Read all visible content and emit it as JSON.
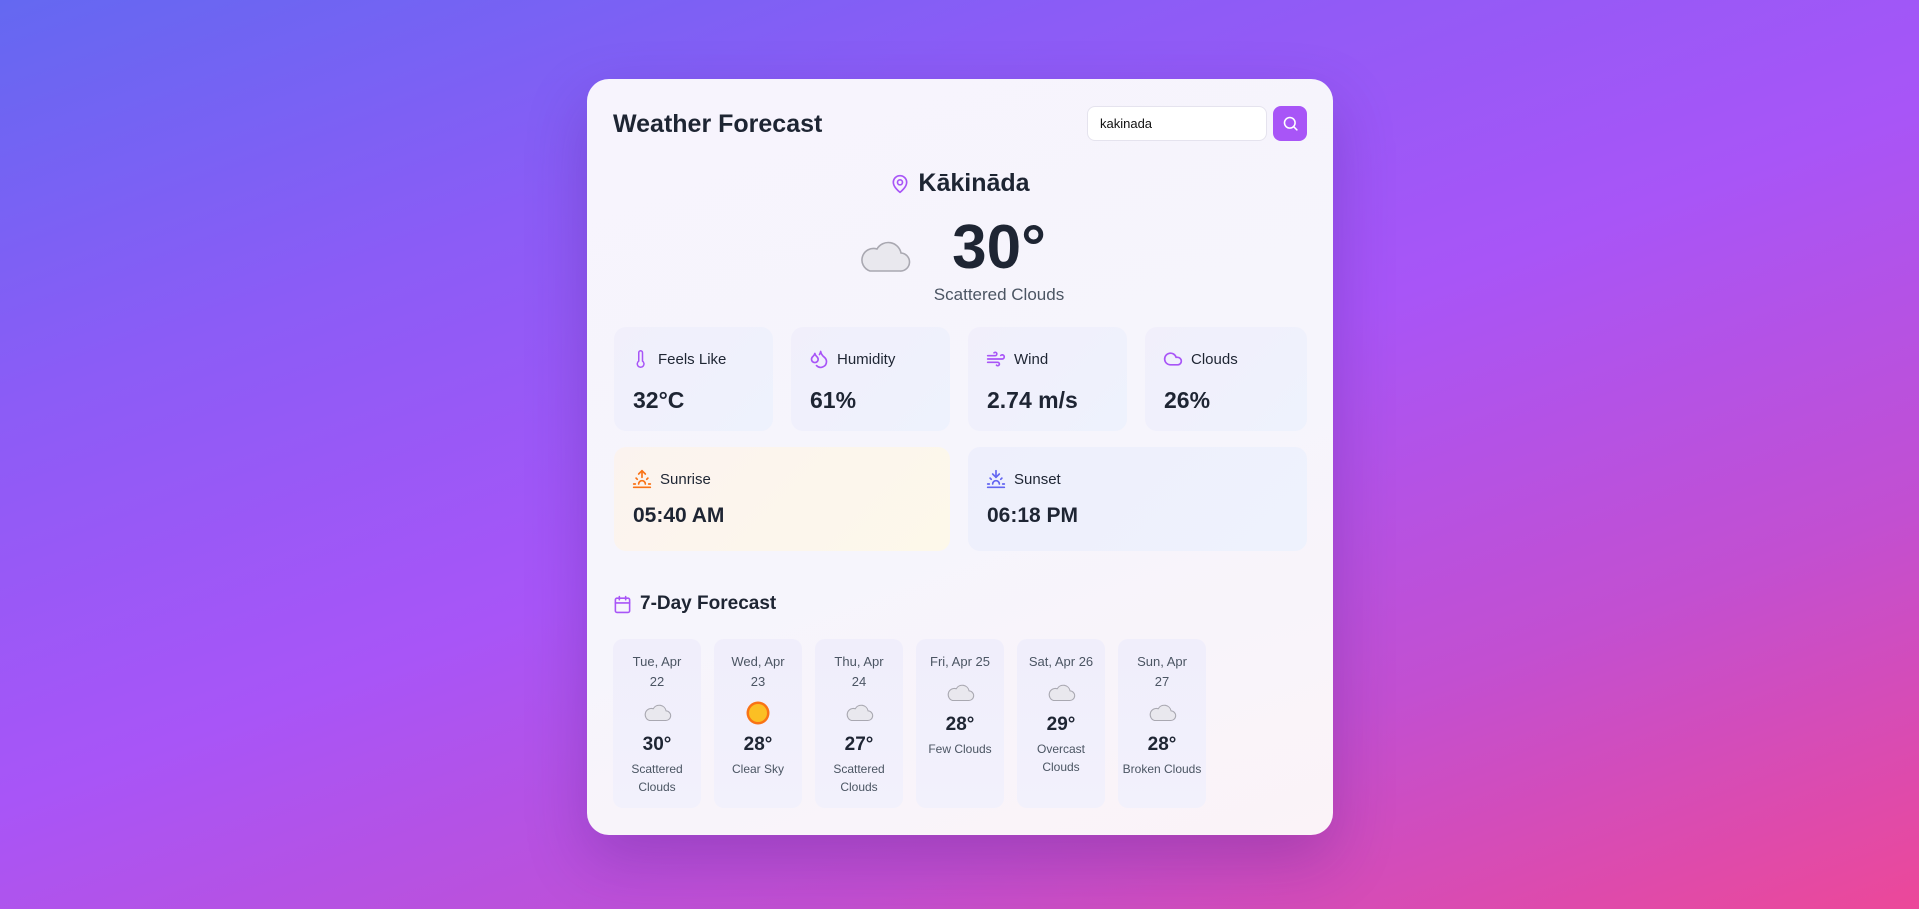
{
  "app": {
    "title": "Weather Forecast"
  },
  "search": {
    "value": "kakinada",
    "placeholder": ""
  },
  "location": {
    "name": "Kākinādа"
  },
  "current": {
    "temperature": "30°",
    "description": "Scattered Clouds",
    "icon": "cloud-icon"
  },
  "stats": [
    {
      "label": "Feels Like",
      "value": "32°C",
      "icon": "thermometer-icon"
    },
    {
      "label": "Humidity",
      "value": "61%",
      "icon": "droplets-icon"
    },
    {
      "label": "Wind",
      "value": "2.74 m/s",
      "icon": "wind-icon"
    },
    {
      "label": "Clouds",
      "value": "26%",
      "icon": "cloud-icon"
    }
  ],
  "sun": {
    "sunrise": {
      "label": "Sunrise",
      "value": "05:40 AM",
      "icon": "sunrise-icon"
    },
    "sunset": {
      "label": "Sunset",
      "value": "06:18 PM",
      "icon": "sunset-icon"
    }
  },
  "forecast": {
    "title": "7-Day Forecast",
    "days": [
      {
        "date": "Tue, Apr 22",
        "temp": "30°",
        "desc": "Scattered Clouds",
        "icon": "cloud-icon"
      },
      {
        "date": "Wed, Apr 23",
        "temp": "28°",
        "desc": "Clear Sky",
        "icon": "sun-icon"
      },
      {
        "date": "Thu, Apr 24",
        "temp": "27°",
        "desc": "Scattered Clouds",
        "icon": "cloud-icon"
      },
      {
        "date": "Fri, Apr 25",
        "temp": "28°",
        "desc": "Few Clouds",
        "icon": "cloud-icon"
      },
      {
        "date": "Sat, Apr 26",
        "temp": "29°",
        "desc": "Overcast Clouds",
        "icon": "cloud-icon"
      },
      {
        "date": "Sun, Apr 27",
        "temp": "28°",
        "desc": "Broken Clouds",
        "icon": "cloud-icon"
      }
    ]
  },
  "colors": {
    "accent": "#a855f7",
    "sunrise": "#f97316",
    "sunset": "#6366f1",
    "text": "#1e2533"
  }
}
